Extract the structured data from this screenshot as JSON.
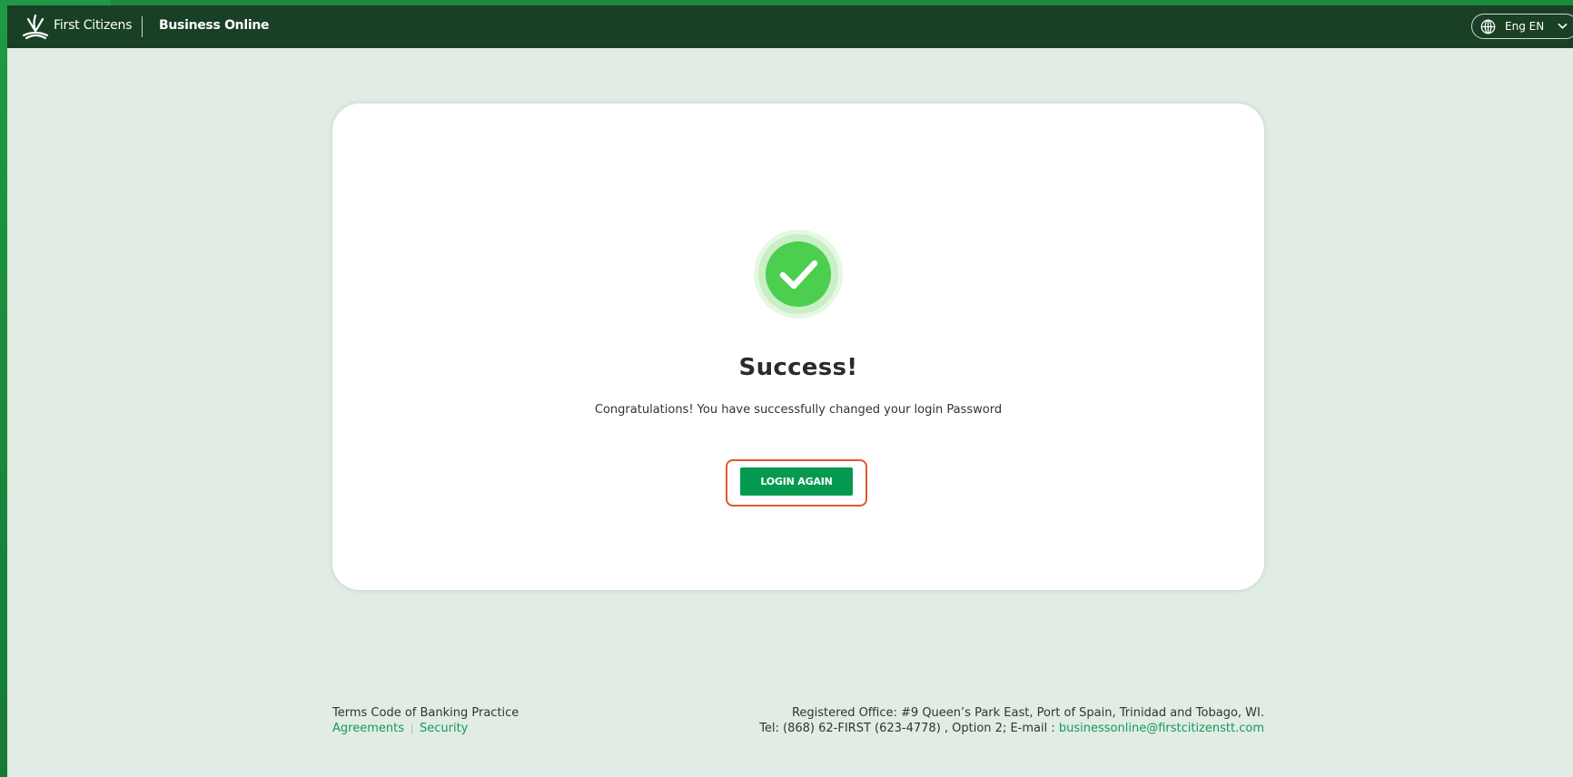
{
  "header": {
    "brand": "First Citizens",
    "product": "Business Online",
    "language": "Eng EN",
    "logo_icon": "first-citizens-logo-icon",
    "globe_icon": "globe-icon",
    "chevron_icon": "chevron-down-icon"
  },
  "card": {
    "icon": "check-circle-icon",
    "title": "Success!",
    "message": "Congratulations! You have successfully changed your login Password",
    "button_label": "LOGIN AGAIN"
  },
  "footer": {
    "terms": "Terms Code of Banking Practice",
    "links": [
      {
        "label": "Agreements"
      },
      {
        "label": "Security"
      }
    ],
    "office": "Registered Office: #9 Queen’s Park East, Port of Spain, Trinidad and Tobago, WI.",
    "contact_prefix": "Tel: (868) 62-FIRST (623-4778) , Option 2; E-mail : ",
    "email": "businessonline@firstcitizenstt.com"
  },
  "colors": {
    "topbar": "#193f24",
    "page_bg": "#e1ece5",
    "accent_green": "#069a50",
    "success_green": "#4cce4e",
    "highlight_outline": "#dc5a2c"
  }
}
